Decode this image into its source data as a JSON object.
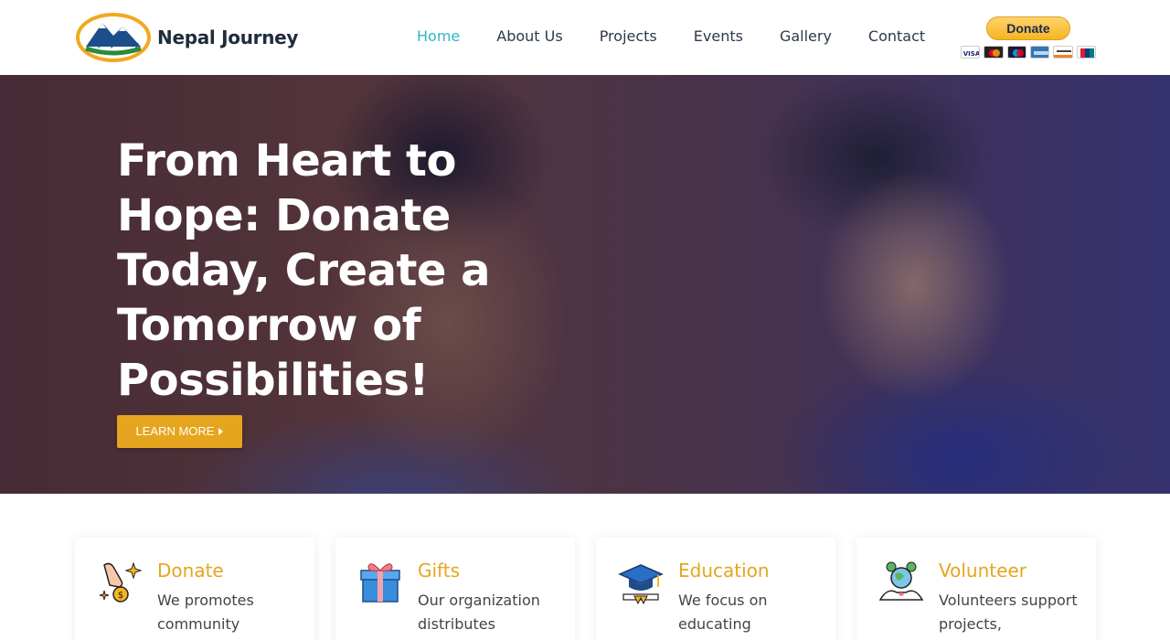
{
  "header": {
    "brand": "Nepal Journey",
    "logo_text": "Nepal Journey",
    "nav": [
      {
        "label": "Home",
        "active": true
      },
      {
        "label": "About Us",
        "active": false
      },
      {
        "label": "Projects",
        "active": false
      },
      {
        "label": "Events",
        "active": false
      },
      {
        "label": "Gallery",
        "active": false
      },
      {
        "label": "Contact",
        "active": false
      }
    ],
    "paypal_label": "Donate",
    "card_icons": [
      "visa-icon",
      "mastercard-icon",
      "maestro-icon",
      "amex-icon",
      "discover-icon",
      "unionpay-icon"
    ]
  },
  "hero": {
    "title": "From Heart to Hope: Donate Today, Create a Tomorrow of Possibilities!",
    "button_label": "LEARN MORE"
  },
  "features": [
    {
      "title": "Donate",
      "text": "We promotes community",
      "icon": "donate-hand-coin-icon"
    },
    {
      "title": "Gifts",
      "text": "Our organization distributes",
      "icon": "gift-box-icon"
    },
    {
      "title": "Education",
      "text": "We focus on educating",
      "icon": "graduation-cap-icon"
    },
    {
      "title": "Volunteer",
      "text": "Volunteers support projects,",
      "icon": "volunteer-globe-icon"
    }
  ],
  "colors": {
    "accent": "#e6a51e",
    "nav_active": "#33b5c5",
    "text_dark": "#2c3a4a",
    "paypal_yellow": "#f6b521",
    "paypal_text": "#1a2a57"
  }
}
